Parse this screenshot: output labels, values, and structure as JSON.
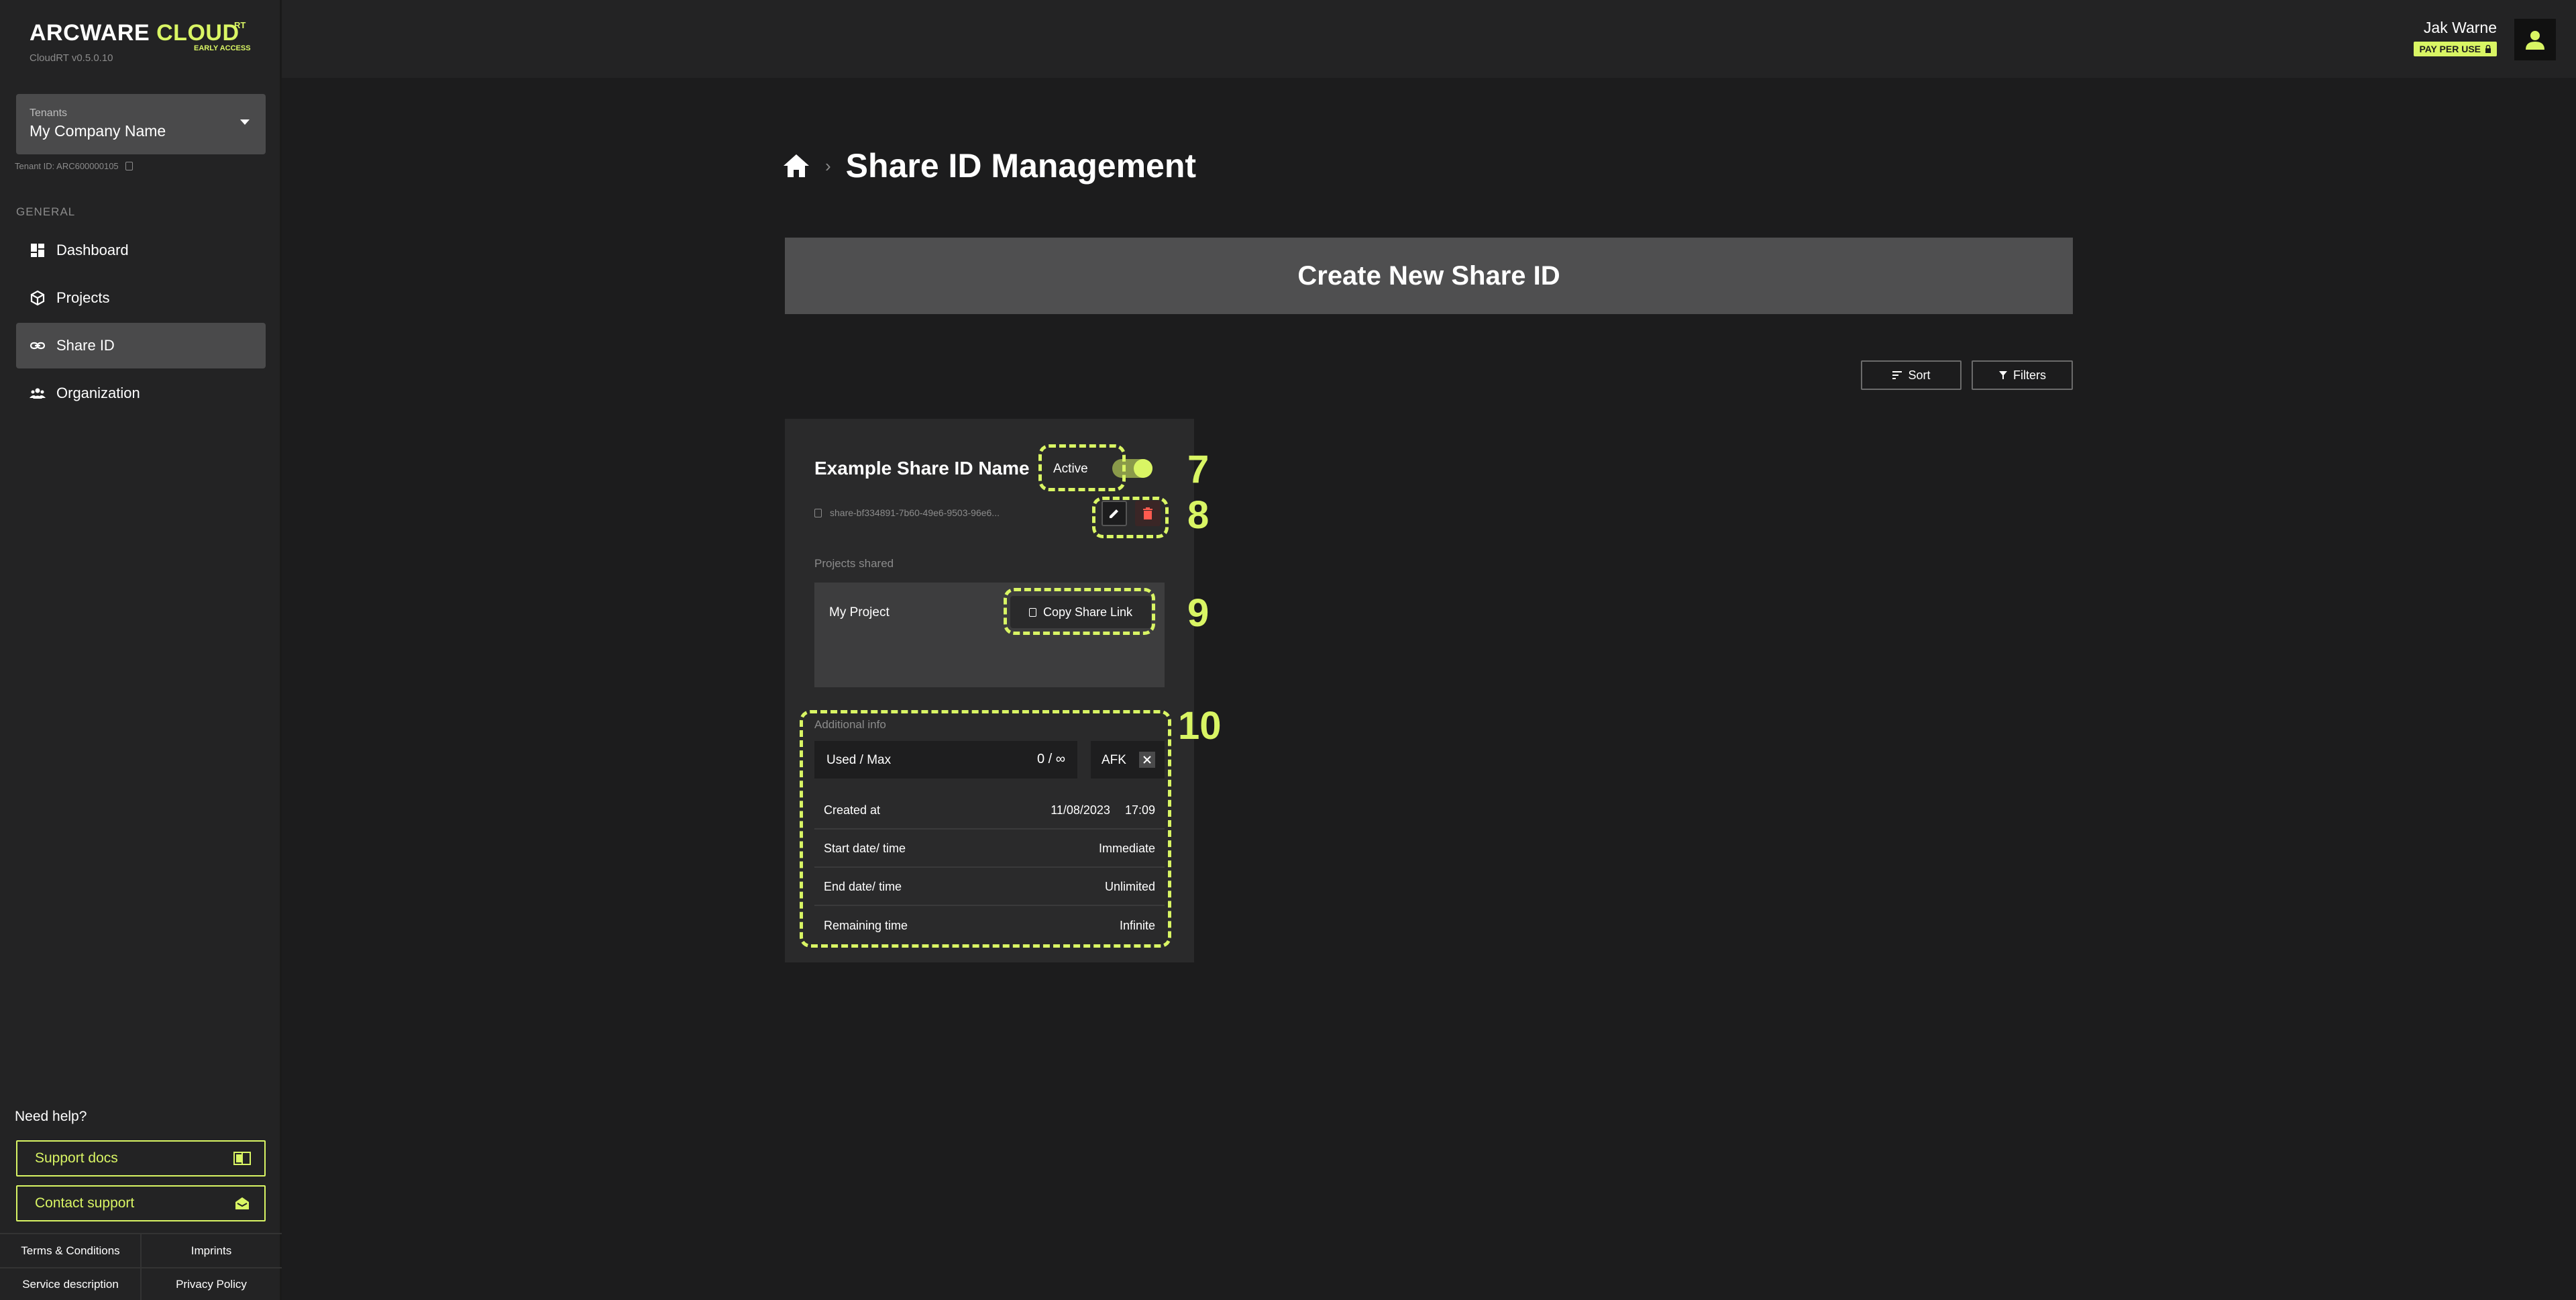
{
  "brand": {
    "name_prefix": "ARCWARE",
    "name_suffix": "CLOUD",
    "superscript": "RT",
    "tag": "EARLY ACCESS",
    "version": "CloudRT v0.5.0.10",
    "accent_color": "#d9f564"
  },
  "tenant": {
    "caption": "Tenants",
    "name": "My Company Name",
    "id_text": "Tenant ID: ARC600000105"
  },
  "sidebar": {
    "section": "GENERAL",
    "items": [
      {
        "label": "Dashboard",
        "icon": "dashboard-icon",
        "active": false
      },
      {
        "label": "Projects",
        "icon": "cube-icon",
        "active": false
      },
      {
        "label": "Share ID",
        "icon": "link-icon",
        "active": true
      },
      {
        "label": "Organization",
        "icon": "people-icon",
        "active": false
      }
    ],
    "help_title": "Need help?",
    "support_docs": "Support docs",
    "contact_support": "Contact support",
    "footer": {
      "terms": "Terms & Conditions",
      "imprints": "Imprints",
      "service": "Service description",
      "privacy": "Privacy Policy"
    }
  },
  "user": {
    "name": "Jak Warne",
    "plan": "PAY PER USE"
  },
  "page": {
    "title": "Share ID Management",
    "create_button": "Create New Share ID",
    "sort": "Sort",
    "filters": "Filters"
  },
  "card": {
    "title": "Example Share ID Name",
    "status": "Active",
    "share_id": "share-bf334891-7b60-49e6-9503-96e6...",
    "projects_label": "Projects shared",
    "project_name": "My Project",
    "copy_link": "Copy Share Link",
    "additional_label": "Additional info",
    "used_caption": "Used / Max",
    "used_value": "0 / ∞",
    "afk": "AFK",
    "rows": [
      {
        "label": "Created at",
        "value": "11/08/2023",
        "value2": "17:09"
      },
      {
        "label": "Start date/ time",
        "value": "Immediate"
      },
      {
        "label": "End date/ time",
        "value": "Unlimited"
      },
      {
        "label": "Remaining time",
        "value": "Infinite"
      }
    ]
  },
  "annotations": [
    "7",
    "8",
    "9",
    "10"
  ]
}
